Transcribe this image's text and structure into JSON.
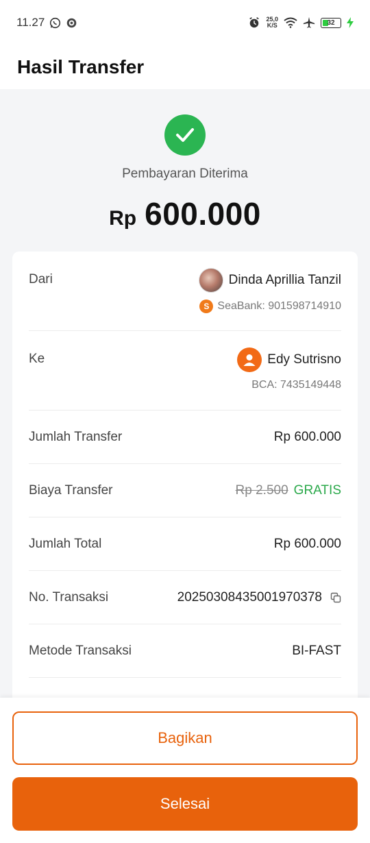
{
  "statusbar": {
    "time": "11.27",
    "speed_value": "25,0",
    "speed_unit": "K/S",
    "battery": "32"
  },
  "header": {
    "title": "Hasil Transfer"
  },
  "result": {
    "status": "Pembayaran Diterima",
    "currency": "Rp",
    "amount": "600.000"
  },
  "details": {
    "from": {
      "label": "Dari",
      "name": "Dinda Aprillia Tanzil",
      "bank": "SeaBank: 901598714910"
    },
    "to": {
      "label": "Ke",
      "name": "Edy Sutrisno",
      "bank": "BCA: 7435149448"
    },
    "transfer_amount": {
      "label": "Jumlah Transfer",
      "value": "Rp 600.000"
    },
    "fee": {
      "label": "Biaya Transfer",
      "original": "Rp 2.500",
      "value": "GRATIS"
    },
    "total": {
      "label": "Jumlah Total",
      "value": "Rp 600.000"
    },
    "transaction_no": {
      "label": "No. Transaksi",
      "value": "20250308435001970378"
    },
    "method": {
      "label": "Metode Transaksi",
      "value": "BI-FAST"
    }
  },
  "actions": {
    "share_label": "Bagikan",
    "done_label": "Selesai"
  },
  "colors": {
    "accent": "#e8620c",
    "success": "#2bb552",
    "free": "#2aa84a"
  }
}
